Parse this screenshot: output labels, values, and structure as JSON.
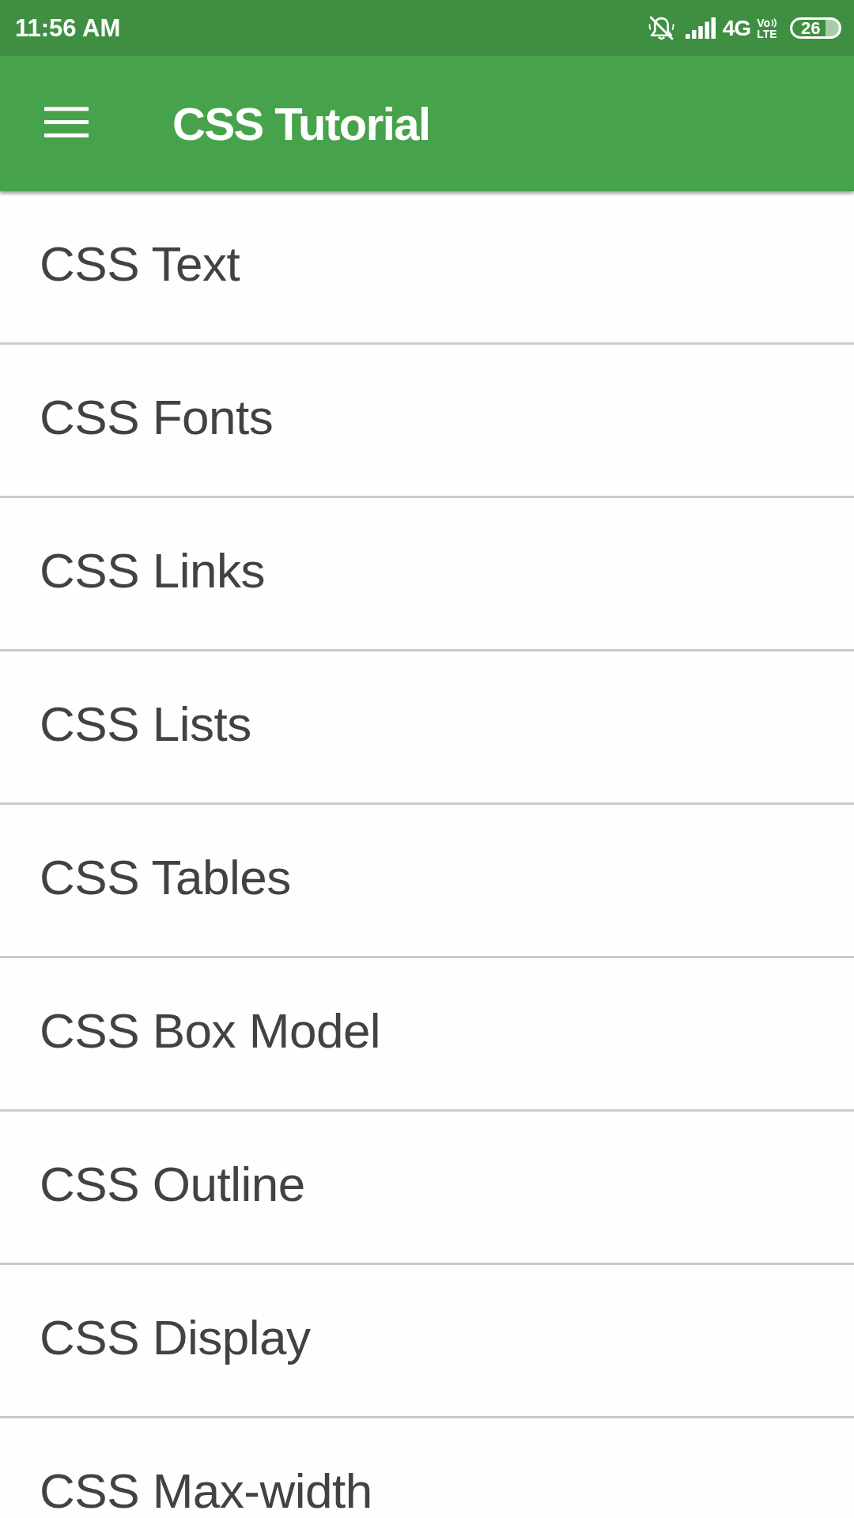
{
  "status_bar": {
    "time": "11:56 AM",
    "network": "4G",
    "volte": {
      "top": "Vo",
      "bottom": "LTE"
    },
    "battery": "26"
  },
  "app_bar": {
    "title": "CSS Tutorial"
  },
  "menu_items": [
    {
      "label": "CSS Text"
    },
    {
      "label": "CSS Fonts"
    },
    {
      "label": "CSS Links"
    },
    {
      "label": "CSS Lists"
    },
    {
      "label": "CSS Tables"
    },
    {
      "label": "CSS Box Model"
    },
    {
      "label": "CSS Outline"
    },
    {
      "label": "CSS Display"
    },
    {
      "label": "CSS Max-width"
    }
  ]
}
